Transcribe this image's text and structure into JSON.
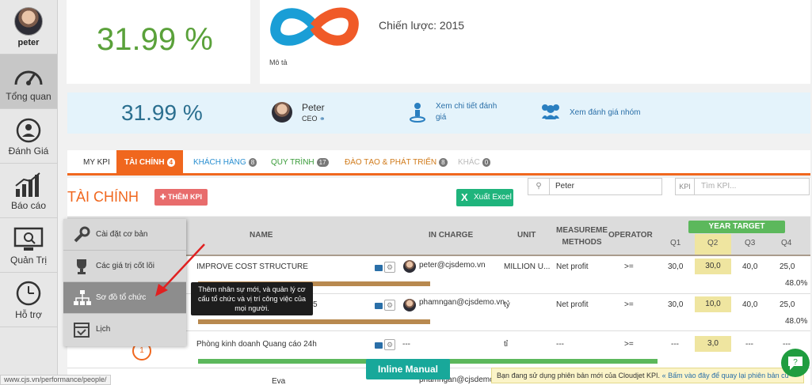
{
  "user": {
    "name": "peter"
  },
  "nav": [
    {
      "label": "Tổng quan",
      "icon": "gauge-icon",
      "active": true
    },
    {
      "label": "Đánh Giá",
      "icon": "people-refresh-icon"
    },
    {
      "label": "Báo cáo",
      "icon": "bar-chart-icon"
    },
    {
      "label": "Quản Trị",
      "icon": "monitor-search-icon"
    },
    {
      "label": "Hỗ trợ",
      "icon": "clock-phone-icon"
    }
  ],
  "top": {
    "percent": "31.99 %",
    "strategy_title": "Chiến lược: 2015",
    "strategy_desc": "Mô tả"
  },
  "summary": {
    "percent": "31.99 %",
    "person_name": "Peter",
    "person_role": "CEO",
    "link_detail_1": "Xem chi tiết đánh",
    "link_detail_2": "giá",
    "link_group": "Xem đánh giá nhóm"
  },
  "tabs": [
    {
      "label": "MY KPI",
      "badge": ""
    },
    {
      "label": "TÀI CHÍNH",
      "badge": "4"
    },
    {
      "label": "KHÁCH HÀNG",
      "badge": "8"
    },
    {
      "label": "QUY TRÌNH",
      "badge": "17"
    },
    {
      "label": "ĐÀO TẠO & PHÁT TRIỂN",
      "badge": "8"
    },
    {
      "label": "KHÁC",
      "badge": "0"
    }
  ],
  "section": {
    "title": "TÀI CHÍNH",
    "add_kpi": "THÊM KPI",
    "export": "Xuất Excel",
    "person_search_value": "Peter",
    "kpi_label": "KPI",
    "kpi_search_placeholder": "Tìm KPI..."
  },
  "columns": {
    "name": "NAME",
    "in_charge": "IN CHARGE",
    "unit": "UNIT",
    "method_1": "MEASUREME",
    "method_2": "METHODS",
    "operator": "OPERATOR",
    "year_target": "YEAR TARGET",
    "q1": "Q1",
    "q2": "Q2",
    "q3": "Q3",
    "q4": "Q4"
  },
  "rows": [
    {
      "name": "IMPROVE COST STRUCTURE",
      "in_charge": "peter@cjsdemo.vn",
      "unit": "MILLION U...",
      "method": "Net profit",
      "operator": ">=",
      "q1": "30,0",
      "q2": "30,0",
      "q3": "40,0",
      "q4": "25,0",
      "progress": 48,
      "progress_label": "48.0%"
    },
    {
      "name": "5",
      "in_charge": "phamngan@cjsdemo.vn",
      "unit": "tỷ",
      "method": "Net profit",
      "operator": ">=",
      "q1": "30,0",
      "q2": "10,0",
      "q3": "40,0",
      "q4": "25,0",
      "progress": 48,
      "progress_label": "48.0%"
    },
    {
      "name": "Phòng kinh doanh Quang cáo 24h",
      "in_charge": "---",
      "unit": "tỉ",
      "method": "---",
      "operator": ">=",
      "q1": "---",
      "q2": "3,0",
      "q3": "---",
      "q4": "---",
      "progress": 0,
      "progress_label": ""
    },
    {
      "name": "Eva",
      "in_charge": "phamngan@cjsdemo.vn"
    }
  ],
  "row_index": "1",
  "popup": [
    {
      "label": "Cài đặt cơ bản",
      "icon": "wrench-icon"
    },
    {
      "label": "Các giá trị cốt lõi",
      "icon": "trophy-icon"
    },
    {
      "label": "Sơ đồ tổ chức",
      "icon": "org-chart-icon",
      "selected": true
    },
    {
      "label": "Lịch",
      "icon": "calendar-check-icon"
    }
  ],
  "tooltip": "Thêm nhân sự mới, và quản lý cơ cấu tổ chức và vị trí công việc của mọi người.",
  "inline_manual": "Inline Manual",
  "notice": {
    "text": "Bạn đang sử dụng phiên bản mới của Cloudjet KPI.",
    "link": "« Bấm vào đây để quay lại phiên bản cũ"
  },
  "status_url": "www.cjs.vn/performance/people/",
  "colors": {
    "accent": "#f0671e",
    "green": "#5aa13a",
    "blue_link": "#2a6fa8",
    "progress_tan": "#b8894f",
    "progress_green": "#5cb85c"
  }
}
